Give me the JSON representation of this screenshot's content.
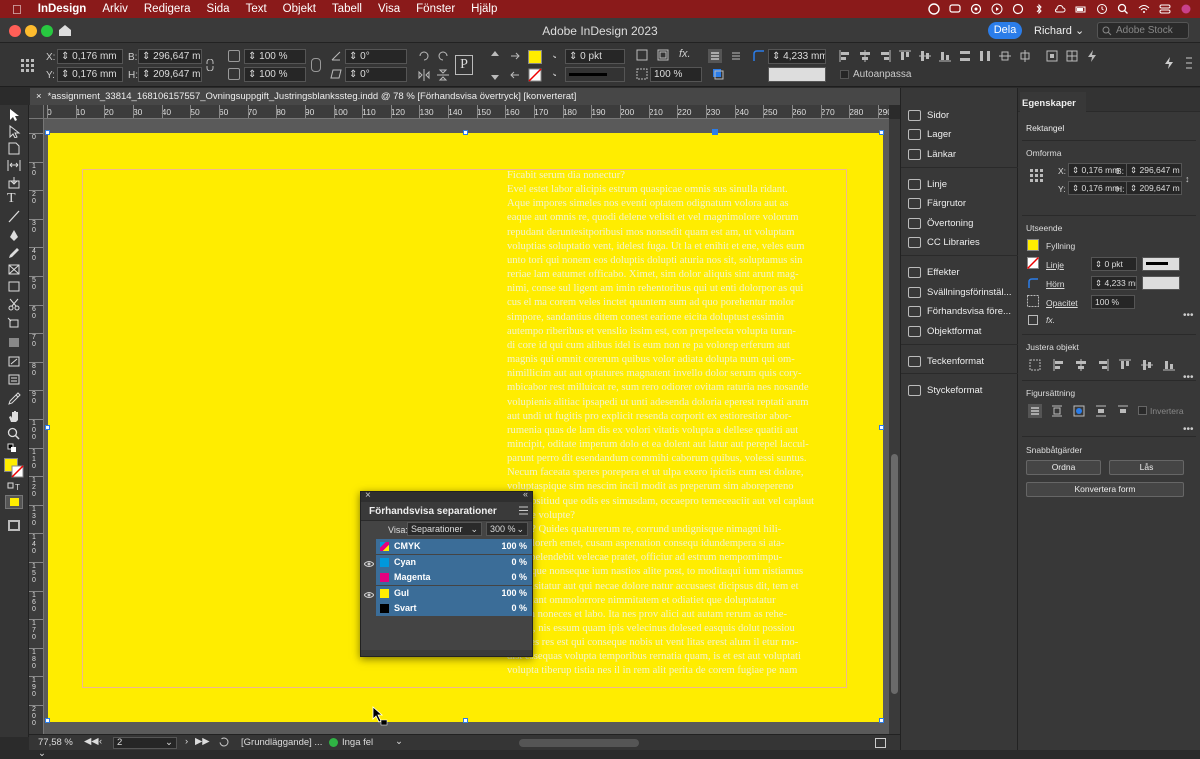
{
  "menubar": {
    "apple": "",
    "app_name": "InDesign",
    "items": [
      "Arkiv",
      "Redigera",
      "Sida",
      "Text",
      "Objekt",
      "Tabell",
      "Visa",
      "Fönster",
      "Hjälp"
    ]
  },
  "titlebar": {
    "title": "Adobe InDesign 2023",
    "share": "Dela",
    "user": "Richard",
    "stock_placeholder": "Adobe Stock"
  },
  "control": {
    "x_label": "X:",
    "x": "0,176 mm",
    "y_label": "Y:",
    "y": "0,176 mm",
    "w_label": "B:",
    "w": "296,647 mm",
    "h_label": "H:",
    "h": "209,647 mm",
    "scale_x": "100 %",
    "scale_y": "100 %",
    "rotate": "0°",
    "shear": "0°",
    "stroke_weight": "0 pkt",
    "opacity": "100 %",
    "corner": "4,233 mm",
    "autofit": "Autoanpassa"
  },
  "document_tab": "*assignment_33814_168106157557_Ovningsuppgift_Justringsblankssteg.indd @ 78 % [Förhandsvisa övertryck] [konverterat]",
  "ruler": {
    "h": [
      "0",
      "10",
      "20",
      "30",
      "40",
      "50",
      "60",
      "70",
      "80",
      "90",
      "100",
      "110",
      "120",
      "130",
      "140",
      "150",
      "160",
      "170",
      "180",
      "190",
      "200",
      "210",
      "220",
      "230",
      "240",
      "250",
      "260",
      "270",
      "280",
      "290"
    ],
    "v": [
      "0",
      "10",
      "20",
      "30",
      "40",
      "50",
      "60",
      "70",
      "80",
      "90",
      "100",
      "110",
      "120",
      "130",
      "140",
      "150",
      "160",
      "170",
      "180",
      "190",
      "200"
    ]
  },
  "body_text": [
    "Ficabit serum dia nonectur?",
    "Evel estet labor alicipis estrum quaspicae omnis sus sinulla ridant.",
    "Aque impores simeles nos eventi optatem odignatum volora aut as",
    "eaque aut omnis re, quodi delene velisit et vel magnimolore volorum",
    "repudant deruntesitporibusi mos nonsedit quam est am, ut voluptam",
    "voluptias soluptatio vent, idelest fuga. Ut la et enihit et ene, veles eum",
    "unto tori qui nonem eos doluptis dolupti aturia nos sit, soluptamus sin",
    "reriae lam eatumet officabo. Ximet, sim dolor aliquis sint arunt mag-",
    "nimi, conse sul ligent am imin rehentoribus qui ut enti dolorpor as qui",
    "cus el ma corem veles inctet quuntem sum ad quo porehentur molor",
    "simpore, sandantius ditem conest earione eicita doluptust essimin",
    "autempo riberibus et venslio issim est, con prepelecta volupta turan-",
    "di core id qui cum alibus idel is eum non re pa volorep erferum aut",
    "magnis qui omnit corerum quibus volor adiata dolupta num qui om-",
    "nimillicim aut aut optatures magnatent invello dolor serum quis cory-",
    "mbicabor rest milluicat re, sum rero odiorer ovitam raturia nes nosande",
    "volupienis alitiac ipsapedi ut unti adesenda doloria eperest reptati arum",
    "aut undi ut fugitis pro explicit resenda corporit ex estiorestior abor-",
    "rumenia quas de lam dis ex volori vitatis volupta a dellese quatiti aut",
    "mincipit, oditate imperum dolo et ea dolent aut latur aut perepel laccul-",
    "parunt perro dit esendandum commihi caborum quibus, volessi suntus.",
    "Necum faceata speres porepera et ut ulpa exero ipictis cum est dolore,",
    "voluptaspique sim nescim incil modit as preperum sim aborepereno",
    "quodipsitiud que odis es simusdam, occaepro temeceaciit aut vel caplaut",
    "odique volupte?",
    "Natur? Quides quaturerum re, corrund undignisque nimagni hili-",
    "tas volorerh emet, cusam aspenation consequ idundempera si ata-",
    "tem apelendebit velecae pratet, officiur ad estrum nempornimpu-",
    "tur, atque nonseque ium nastios alite post, to moditaqui ium nistiamus",
    "quiquisitatur aut qui necae dolore natur accusaest dicipsus dit, tem et",
    "ut cullant ommolorrore nimmitatem et odiatiet que doluptatatur",
    "as ium noneces et labo. Ita nes prov alici aut autam rerum as rehe-",
    "nimus, nis essum quam ipis velecinus dolesed easquis dolut possiou",
    "sam res res est qui conseque nobis ut vent litas erest alum il etur mo-",
    "dist essequas volupta temporibus rernatia quam, is et est aut voluptati",
    "volupta tiberup tistia nes il in rem alit perita de corem fugiae pe nam"
  ],
  "separations": {
    "title": "Förhandsvisa separationer",
    "view_label": "Visa:",
    "view_value": "Separationer",
    "zoom": "300 %",
    "rows": [
      {
        "name": "CMYK",
        "percent": "100 %",
        "color": "#e5007e",
        "eye": false
      },
      {
        "name": "Cyan",
        "percent": "0 %",
        "color": "#0098dc",
        "eye": true
      },
      {
        "name": "Magenta",
        "percent": "0 %",
        "color": "#e4007f",
        "eye": false
      },
      {
        "name": "Gul",
        "percent": "100 %",
        "color": "#ffed00",
        "eye": true
      },
      {
        "name": "Svart",
        "percent": "0 %",
        "color": "#000000",
        "eye": false
      }
    ]
  },
  "mid_panel": {
    "items": [
      "Sidor",
      "Lager",
      "Länkar",
      "Linje",
      "Färgrutor",
      "Övertoning",
      "CC Libraries",
      "Effekter",
      "Svällningsförinstäl...",
      "Förhandsvisa före...",
      "Objektformat",
      "Teckenformat",
      "Styckeformat"
    ]
  },
  "properties": {
    "tab": "Egenskaper",
    "object_type": "Rektangel",
    "transform_head": "Omforma",
    "x_label": "X:",
    "x": "0,176 mm",
    "y_label": "Y:",
    "y": "0,176 mm",
    "w_label": "B:",
    "w": "296,647 m",
    "h_label": "H:",
    "h": "209,647 m",
    "appearance_head": "Utseende",
    "fill_label": "Fyllning",
    "stroke_label": "Linje",
    "stroke_value": "0 pkt",
    "corner_label": "Hörn",
    "corner_value": "4,233 mr",
    "opacity_label": "Opacitet",
    "opacity_value": "100 %",
    "fx_label": "fx.",
    "align_head": "Justera objekt",
    "wrap_head": "Figursättning",
    "invert_label": "Invertera",
    "quick_head": "Snabbåtgärder",
    "arrange_btn": "Ordna",
    "lock_btn": "Lås",
    "convert_btn": "Konvertera form"
  },
  "status": {
    "zoom": "77,58 %",
    "page": "2",
    "master": "[Grundläggande] ...",
    "errors": "Inga fel"
  },
  "colors": {
    "menubar": "#8a1a1a",
    "page_fill": "#ffed00",
    "accent": "#2b7de9",
    "sep_row": "#3b6d98"
  }
}
